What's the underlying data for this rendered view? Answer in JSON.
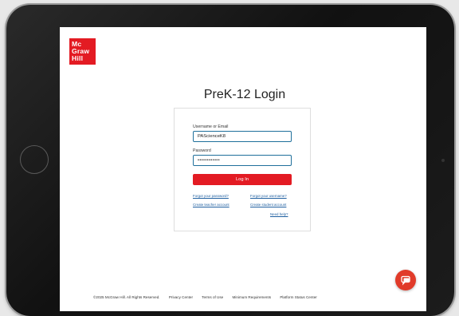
{
  "logo": {
    "lines": [
      "Mc",
      "Graw",
      "Hill"
    ]
  },
  "page": {
    "title": "PreK-12 Login"
  },
  "form": {
    "username_label": "Username or Email",
    "username_value": "PAScienceK8",
    "password_label": "Password",
    "password_value": "••••••••••••",
    "login_label": "Log In",
    "links": {
      "forgot_password": "Forgot your password?",
      "forgot_username": "Forgot your username?",
      "create_teacher": "Create teacher account",
      "create_student": "Create student account",
      "need_help": "Need help?"
    }
  },
  "footer": {
    "copyright": "©2025 McGraw Hill. All Rights Reserved.",
    "privacy": "Privacy Center",
    "terms": "Terms of Use",
    "requirements": "Minimum Requirements",
    "status": "Platform Status Center"
  },
  "icons": {
    "help": "chat-help-icon"
  },
  "colors": {
    "brand_red": "#e31b23",
    "link_blue": "#1f5fa0",
    "field_border": "#1f6f9b"
  }
}
